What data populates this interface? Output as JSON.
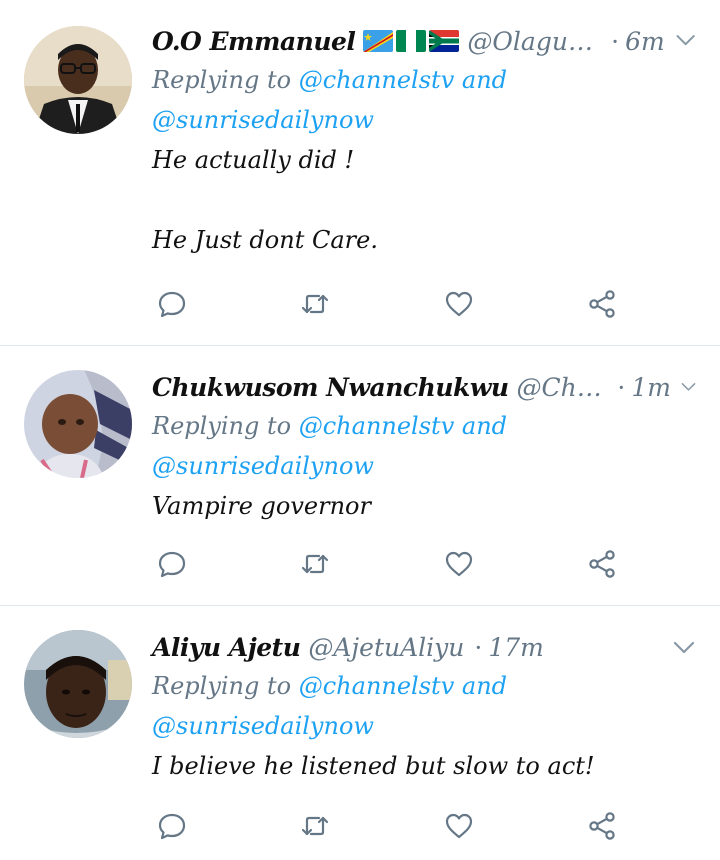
{
  "tweets": [
    {
      "display_name": "O.O Emmanuel",
      "flags": [
        "flag-drc-icon",
        "flag-nigeria-icon",
        "flag-south-africa-icon"
      ],
      "handle": "@Olagunj...",
      "separator": "·",
      "time": "6m",
      "replying_prefix": "Replying to",
      "mention_1": "@channelstv",
      "conjunction": "and",
      "mention_2": "@sunrisedailynow",
      "text_lines": [
        "He actually did !",
        "",
        "He Just dont Care."
      ]
    },
    {
      "display_name": "Chukwusom Nwanchukwu",
      "handle": "@Chukw...",
      "separator": "·",
      "time": "1m",
      "replying_prefix": "Replying to",
      "mention_1": "@channelstv",
      "conjunction": "and",
      "mention_2": "@sunrisedailynow",
      "text_lines": [
        "Vampire governor"
      ]
    },
    {
      "display_name": "Aliyu Ajetu",
      "handle": "@AjetuAliyu",
      "separator": "·",
      "time": "17m",
      "replying_prefix": "Replying to",
      "mention_1": "@channelstv",
      "conjunction": "and",
      "mention_2": "@sunrisedailynow",
      "text_lines": [
        "I believe he listened but slow to act!"
      ]
    }
  ],
  "icons": {
    "reply": "reply-icon",
    "retweet": "retweet-icon",
    "like": "heart-icon",
    "share": "share-icon",
    "menu": "chevron-down-icon"
  },
  "colors": {
    "text": "#111111",
    "muted": "#657786",
    "link": "#1da1f2",
    "divider": "#e1e8ed"
  }
}
